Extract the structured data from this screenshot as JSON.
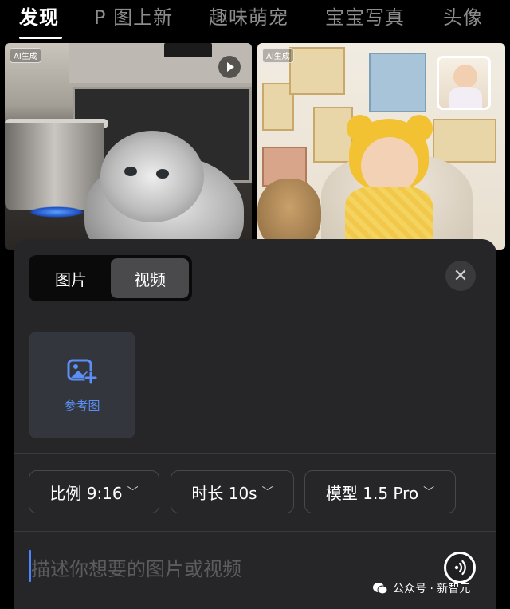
{
  "tabs": {
    "items": [
      {
        "label": "发现",
        "active": true
      },
      {
        "label": "P 图上新"
      },
      {
        "label": "趣味萌宠"
      },
      {
        "label": "宝宝写真"
      },
      {
        "label": "头像"
      }
    ]
  },
  "feed": {
    "left_card": {
      "badge": "AI生成",
      "has_play": true
    },
    "right_card": {
      "badge": "AI生成"
    }
  },
  "panel": {
    "segment": {
      "image_label": "图片",
      "video_label": "视频",
      "selected": "视频"
    },
    "close_icon": "close-icon",
    "reference": {
      "label": "参考图",
      "icon": "add-image-icon"
    },
    "options": {
      "ratio": "比例 9:16",
      "duration": "时长 10s",
      "model": "模型 1.5 Pro"
    },
    "prompt": {
      "placeholder": "描述你想要的图片或视频"
    },
    "voice_icon": "voice-input-icon"
  },
  "watermark": {
    "text": "公众号 · 新智元"
  },
  "colors": {
    "accent_blue": "#4c86ff",
    "panel_bg": "#262629",
    "active_segment": "#4a4a4c"
  }
}
